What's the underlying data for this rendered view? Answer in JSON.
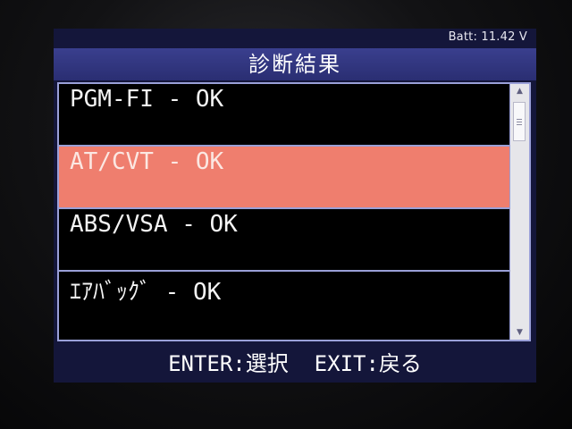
{
  "status": {
    "battery": "Batt: 11.42 V"
  },
  "header": {
    "title": "診断結果"
  },
  "list": {
    "items": [
      {
        "label": "PGM-FI - OK",
        "selected": false
      },
      {
        "label": "AT/CVT - OK",
        "selected": true
      },
      {
        "label": "ABS/VSA - OK",
        "selected": false
      },
      {
        "label": "ｴｱﾊﾞｯｸﾞ - OK",
        "selected": false
      }
    ]
  },
  "footer": {
    "enter_hint": "ENTER:選択",
    "exit_hint": "EXIT:戻る"
  },
  "colors": {
    "title_bar": "#2f337a",
    "selected_row": "#ef7e6e",
    "screen_bg": "#14163a",
    "list_bg": "#000000"
  }
}
